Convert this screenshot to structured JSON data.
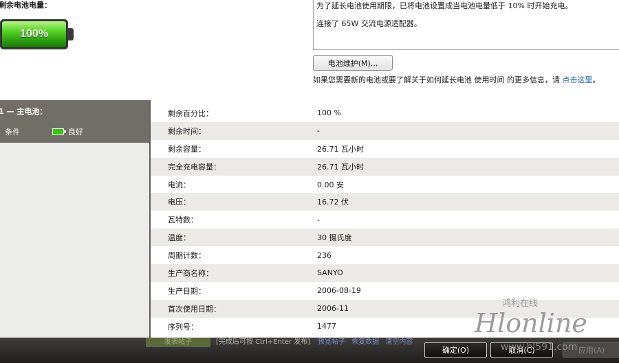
{
  "battery_status": {
    "charge_label": "剩余电池电量：",
    "charge_percent_text": "100%",
    "charge_level": 1.0,
    "info_lines": [
      "为了延长电池使用期限，已将电池设置成当电池电量低于 10% 时开始充电。",
      "连接了 65W 交流电源适配器。"
    ],
    "maintenance_button": "电池维护(M)...",
    "help_text": "如果您需要新的电池或要了解关于如何延长电池 使用时间 的更多信息，请",
    "help_link": "点击这里",
    "help_suffix": "。"
  },
  "left_panel": {
    "title": "1 — 主电池：",
    "condition_label": "条件",
    "condition_value": "良好"
  },
  "details": [
    {
      "label": "剩余百分比：",
      "value": "100 %"
    },
    {
      "label": "剩余时间：",
      "value": "-"
    },
    {
      "label": "剩余容量：",
      "value": "26.71 瓦小时"
    },
    {
      "label": "完全充电容量：",
      "value": "26.71 瓦小时"
    },
    {
      "label": "电流：",
      "value": "0.00 安"
    },
    {
      "label": "电压：",
      "value": "16.72 伏"
    },
    {
      "label": "瓦特数：",
      "value": "-"
    },
    {
      "label": "温度：",
      "value": "30 摄氏度"
    },
    {
      "label": "周期计数：",
      "value": "236"
    },
    {
      "label": "生产商名称：",
      "value": "SANYO"
    },
    {
      "label": "生产日期：",
      "value": "2006-08-19"
    },
    {
      "label": "首次使用日期：",
      "value": "2006-11"
    },
    {
      "label": "序列号：",
      "value": "1477"
    }
  ],
  "bottom_bar": {
    "post_button": "发表帖子",
    "hint_text": "[完成后可按 Ctrl+Enter 发布]",
    "links": [
      "预览帖子",
      "恢复数据",
      "清空内容"
    ]
  },
  "dialog_buttons": {
    "ok": "确定(O)",
    "cancel": "取消(C)",
    "apply": "应用(A)"
  },
  "watermark": {
    "chinese": "鸿利在线",
    "brand": "Hlonline",
    "url": "www.hl591.com"
  },
  "colors": {
    "battery_green": "#3bbf1a",
    "left_header": "#716e68",
    "link_blue": "#1a5fb4",
    "row_alt": "#ebeae7"
  }
}
